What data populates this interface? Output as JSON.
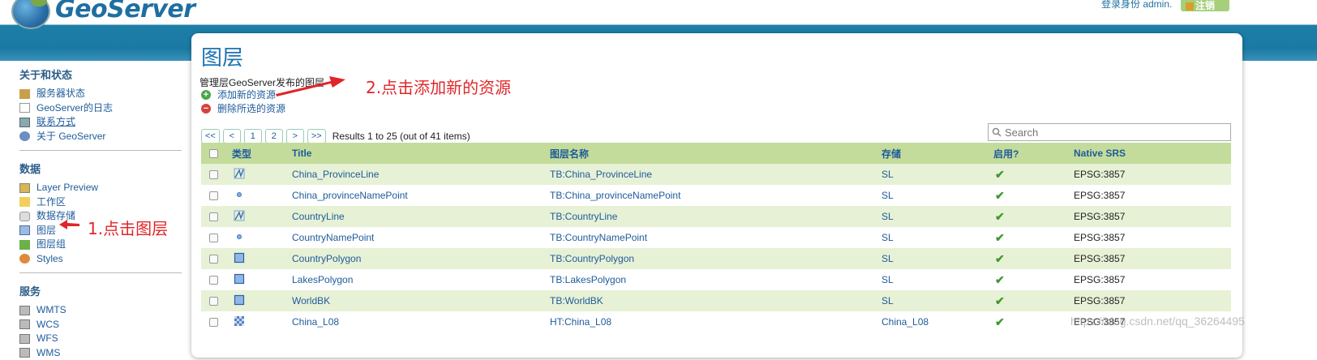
{
  "header": {
    "brand": "GeoServer",
    "login_text": "登录身份 admin.",
    "logout_label": "注销"
  },
  "sidebar": {
    "sections": [
      {
        "title": "关于和状态",
        "items": [
          {
            "label": "服务器状态",
            "icon": "server-status-icon"
          },
          {
            "label": "GeoServer的日志",
            "icon": "log-icon"
          },
          {
            "label": "联系方式",
            "icon": "contact-icon"
          },
          {
            "label": "关于 GeoServer",
            "icon": "about-icon"
          }
        ]
      },
      {
        "title": "数据",
        "items": [
          {
            "label": "Layer Preview",
            "icon": "layer-preview-icon"
          },
          {
            "label": "工作区",
            "icon": "folder-icon"
          },
          {
            "label": "数据存储",
            "icon": "database-icon"
          },
          {
            "label": "图层",
            "icon": "layer-icon"
          },
          {
            "label": "图层组",
            "icon": "layer-group-icon"
          },
          {
            "label": "Styles",
            "icon": "styles-icon"
          }
        ]
      },
      {
        "title": "服务",
        "items": [
          {
            "label": "WMTS",
            "icon": "service-icon"
          },
          {
            "label": "WCS",
            "icon": "service-icon"
          },
          {
            "label": "WFS",
            "icon": "service-icon"
          },
          {
            "label": "WMS",
            "icon": "service-icon"
          }
        ]
      }
    ]
  },
  "page": {
    "title": "图层",
    "description": "管理层GeoServer发布的图层",
    "add_label": "添加新的资源",
    "remove_label": "删除所选的资源"
  },
  "pager": {
    "first": "<<",
    "prev": "<",
    "pages": [
      "1",
      "2"
    ],
    "next": ">",
    "last": ">>",
    "results": "Results 1 to 25 (out of 41 items)"
  },
  "search": {
    "placeholder": "Search"
  },
  "table": {
    "headers": [
      "类型",
      "Title",
      "图层名称",
      "存储",
      "启用?",
      "Native SRS"
    ],
    "rows": [
      {
        "type": "line",
        "title": "China_ProvinceLine",
        "name": "TB:China_ProvinceLine",
        "store": "SL",
        "enabled": "✔",
        "srs": "EPSG:3857"
      },
      {
        "type": "point",
        "title": "China_provinceNamePoint",
        "name": "TB:China_provinceNamePoint",
        "store": "SL",
        "enabled": "✔",
        "srs": "EPSG:3857"
      },
      {
        "type": "line",
        "title": "CountryLine",
        "name": "TB:CountryLine",
        "store": "SL",
        "enabled": "✔",
        "srs": "EPSG:3857"
      },
      {
        "type": "point",
        "title": "CountryNamePoint",
        "name": "TB:CountryNamePoint",
        "store": "SL",
        "enabled": "✔",
        "srs": "EPSG:3857"
      },
      {
        "type": "polygon",
        "title": "CountryPolygon",
        "name": "TB:CountryPolygon",
        "store": "SL",
        "enabled": "✔",
        "srs": "EPSG:3857"
      },
      {
        "type": "polygon",
        "title": "LakesPolygon",
        "name": "TB:LakesPolygon",
        "store": "SL",
        "enabled": "✔",
        "srs": "EPSG:3857"
      },
      {
        "type": "polygon",
        "title": "WorldBK",
        "name": "TB:WorldBK",
        "store": "SL",
        "enabled": "✔",
        "srs": "EPSG:3857"
      },
      {
        "type": "raster",
        "title": "China_L08",
        "name": "HT:China_L08",
        "store": "China_L08",
        "enabled": "✔",
        "srs": "EPSG:3857"
      }
    ]
  },
  "annotations": {
    "step1": "1.点击图层",
    "step2": "2.点击添加新的资源"
  },
  "watermark": "https://blog.csdn.net/qq_36264495",
  "colors": {
    "header_blue": "#1d7ea8",
    "table_header": "#c4dc9b",
    "row_alt": "#e7f1d6",
    "annotation_red": "#e0262a",
    "link_blue": "#1e5b9a"
  }
}
